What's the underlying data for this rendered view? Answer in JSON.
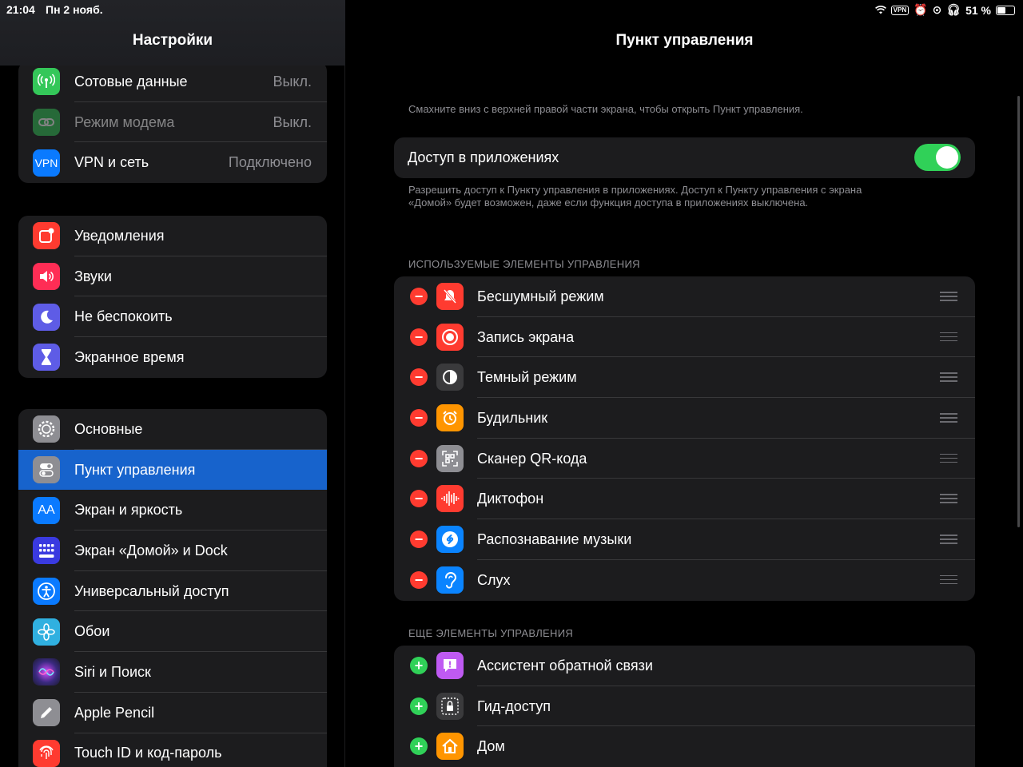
{
  "status_bar": {
    "time": "21:04",
    "date": "Пн 2 нояб.",
    "vpn": "VPN",
    "battery": "51 %",
    "battery_level": 0.51
  },
  "sidebar": {
    "title": "Настройки",
    "groups": [
      {
        "items": [
          {
            "label": "Сотовые данные",
            "value": "Выкл.",
            "icon": "antenna-icon",
            "color": "#34c759"
          },
          {
            "label": "Режим модема",
            "value": "Выкл.",
            "icon": "hotspot-icon",
            "color": "#34c759"
          },
          {
            "label": "VPN и сеть",
            "value": "Подключено",
            "icon": "vpn-icon",
            "icon_text": "VPN",
            "color": "#0a7aff"
          }
        ]
      },
      {
        "items": [
          {
            "label": "Уведомления",
            "icon": "notifications-icon",
            "color": "#ff3b30"
          },
          {
            "label": "Звуки",
            "icon": "speaker-icon",
            "color": "#ff2d55"
          },
          {
            "label": "Не беспокоить",
            "icon": "moon-icon",
            "color": "#5e5ce6"
          },
          {
            "label": "Экранное время",
            "icon": "hourglass-icon",
            "color": "#5e5ce6"
          }
        ]
      },
      {
        "items": [
          {
            "label": "Основные",
            "icon": "gear-icon",
            "color": "#8e8e93"
          },
          {
            "label": "Пункт управления",
            "icon": "switches-icon",
            "color": "#8e8e93"
          },
          {
            "label": "Экран и яркость",
            "icon": "text-size-icon",
            "icon_text": "AA",
            "color": "#0a7aff"
          },
          {
            "label": "Экран «Домой» и Dock",
            "icon": "home-grid-icon",
            "color": "#3a3ae0"
          },
          {
            "label": "Универсальный доступ",
            "icon": "accessibility-icon",
            "color": "#0a7aff"
          },
          {
            "label": "Обои",
            "icon": "flower-icon",
            "color": "#30b0e0"
          },
          {
            "label": "Siri и Поиск",
            "icon": "siri-icon",
            "color": "#2c2c54"
          },
          {
            "label": "Apple Pencil",
            "icon": "pencil-icon",
            "color": "#8e8e93"
          },
          {
            "label": "Touch ID и код-пароль",
            "icon": "fingerprint-icon",
            "color": "#ff3b30"
          }
        ]
      }
    ],
    "selected": "Пункт управления"
  },
  "detail": {
    "title": "Пункт управления",
    "hint_top": "Смахните вниз с верхней правой части экрана, чтобы открыть Пункт управления.",
    "access_label": "Доступ в приложениях",
    "access_enabled": true,
    "access_footer_1": "Разрешить доступ к Пункту управления в приложениях. Доступ к Пункту управления с экрана",
    "access_footer_2": "«Домой» будет возможен, даже если функция доступа в приложениях выключена.",
    "included_header": "ИСПОЛЬЗУЕМЫЕ ЭЛЕМЕНТЫ УПРАВЛЕНИЯ",
    "included": [
      {
        "label": "Бесшумный режим",
        "icon": "bell-slash-icon",
        "color": "#ff3b30"
      },
      {
        "label": "Запись экрана",
        "icon": "record-icon",
        "color": "#ff3b30"
      },
      {
        "label": "Темный режим",
        "icon": "dark-mode-icon",
        "color": "#3a3a3c"
      },
      {
        "label": "Будильник",
        "icon": "alarm-icon",
        "color": "#ff9500"
      },
      {
        "label": "Сканер QR-кода",
        "icon": "qr-code-icon",
        "color": "#8e8e93"
      },
      {
        "label": "Диктофон",
        "icon": "waveform-icon",
        "color": "#ff3b30"
      },
      {
        "label": "Распознавание музыки",
        "icon": "shazam-icon",
        "color": "#0a84ff"
      },
      {
        "label": "Слух",
        "icon": "ear-icon",
        "color": "#0a84ff"
      }
    ],
    "more_header": "ЕЩЕ ЭЛЕМЕНТЫ УПРАВЛЕНИЯ",
    "more": [
      {
        "label": "Ассистент обратной связи",
        "icon": "feedback-icon",
        "color": "#bf5af2"
      },
      {
        "label": "Гид-доступ",
        "icon": "lock-icon",
        "color": "#3a3a3c"
      },
      {
        "label": "Дом",
        "icon": "home-icon",
        "color": "#ff9500"
      }
    ]
  }
}
